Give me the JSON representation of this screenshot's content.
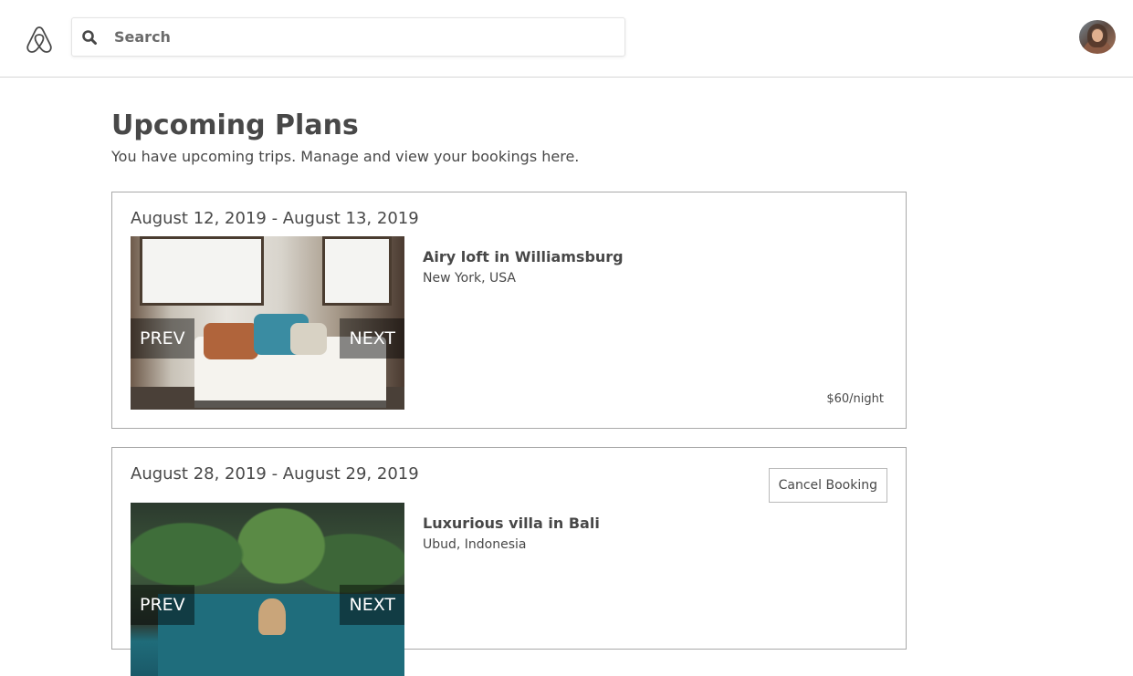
{
  "header": {
    "logo_icon": "airbnb-logo-icon",
    "search_placeholder": "Search",
    "search_icon": "search-icon",
    "avatar_icon": "user-avatar"
  },
  "page": {
    "title": "Upcoming Plans",
    "subtitle": "You have upcoming trips. Manage and view your bookings here."
  },
  "bookings": [
    {
      "dates": "August 12, 2019 - August 13, 2019",
      "title": "Airy loft in Williamsburg",
      "location": "New York, USA",
      "price": "$60/night",
      "prev_label": "PREV",
      "next_label": "NEXT"
    },
    {
      "dates": "August 28, 2019 - August 29, 2019",
      "title": "Luxurious villa in Bali",
      "location": "Ubud, Indonesia",
      "cancel_label": "Cancel Booking",
      "prev_label": "PREV",
      "next_label": "NEXT"
    }
  ],
  "colors": {
    "text": "#484848",
    "border": "#a9a9a9",
    "brand_logo": "#484848"
  }
}
